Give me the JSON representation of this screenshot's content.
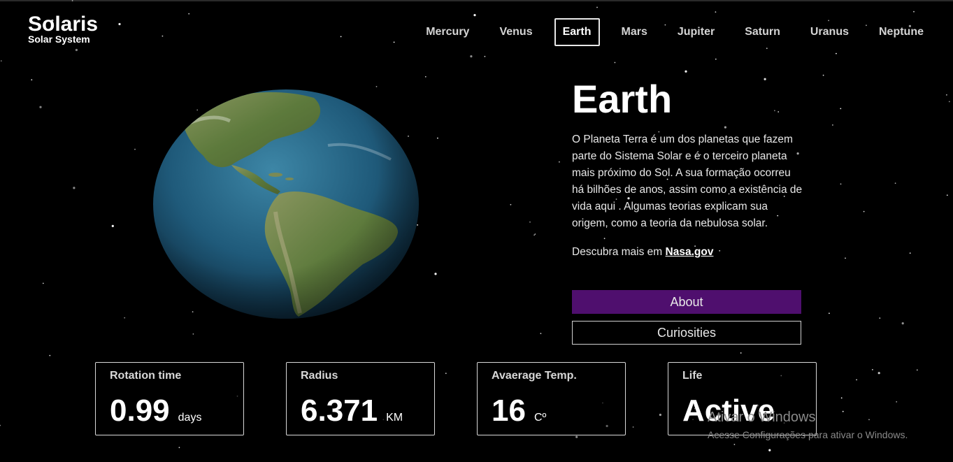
{
  "brand": {
    "title": "Solaris",
    "subtitle": "Solar System"
  },
  "nav": {
    "items": [
      {
        "label": "Mercury",
        "active": false
      },
      {
        "label": "Venus",
        "active": false
      },
      {
        "label": "Earth",
        "active": true
      },
      {
        "label": "Mars",
        "active": false
      },
      {
        "label": "Jupiter",
        "active": false
      },
      {
        "label": "Saturn",
        "active": false
      },
      {
        "label": "Uranus",
        "active": false
      },
      {
        "label": "Neptune",
        "active": false
      }
    ]
  },
  "planet": {
    "name": "Earth",
    "description": "O Planeta Terra é um dos planetas que fazem parte do Sistema Solar e é o terceiro planeta mais próximo do Sol. A sua formação ocorreu há bilhões de anos, assim como a existência de vida aqui . Algumas teorias explicam sua origem, como a teoria da nebulosa solar.",
    "more_prefix": "Descubra mais em ",
    "more_link": "Nasa.gov",
    "image": "earth-globe"
  },
  "buttons": {
    "about": "About",
    "curiosities": "Curiosities"
  },
  "stats": [
    {
      "label": "Rotation time",
      "value": "0.99",
      "unit": "days"
    },
    {
      "label": "Radius",
      "value": "6.371",
      "unit": "KM"
    },
    {
      "label": "Avaerage Temp.",
      "value": "16",
      "unit": "Cº"
    },
    {
      "label": "Life",
      "value": "Active",
      "unit": ""
    }
  ],
  "watermark": {
    "title": "Ativar o Windows",
    "subtitle": "Acesse Configurações para ativar o Windows."
  },
  "colors": {
    "background": "#000000",
    "accent": "#4f0f6e",
    "ocean": "#1f5a7a",
    "land": "#5d7a3c"
  }
}
